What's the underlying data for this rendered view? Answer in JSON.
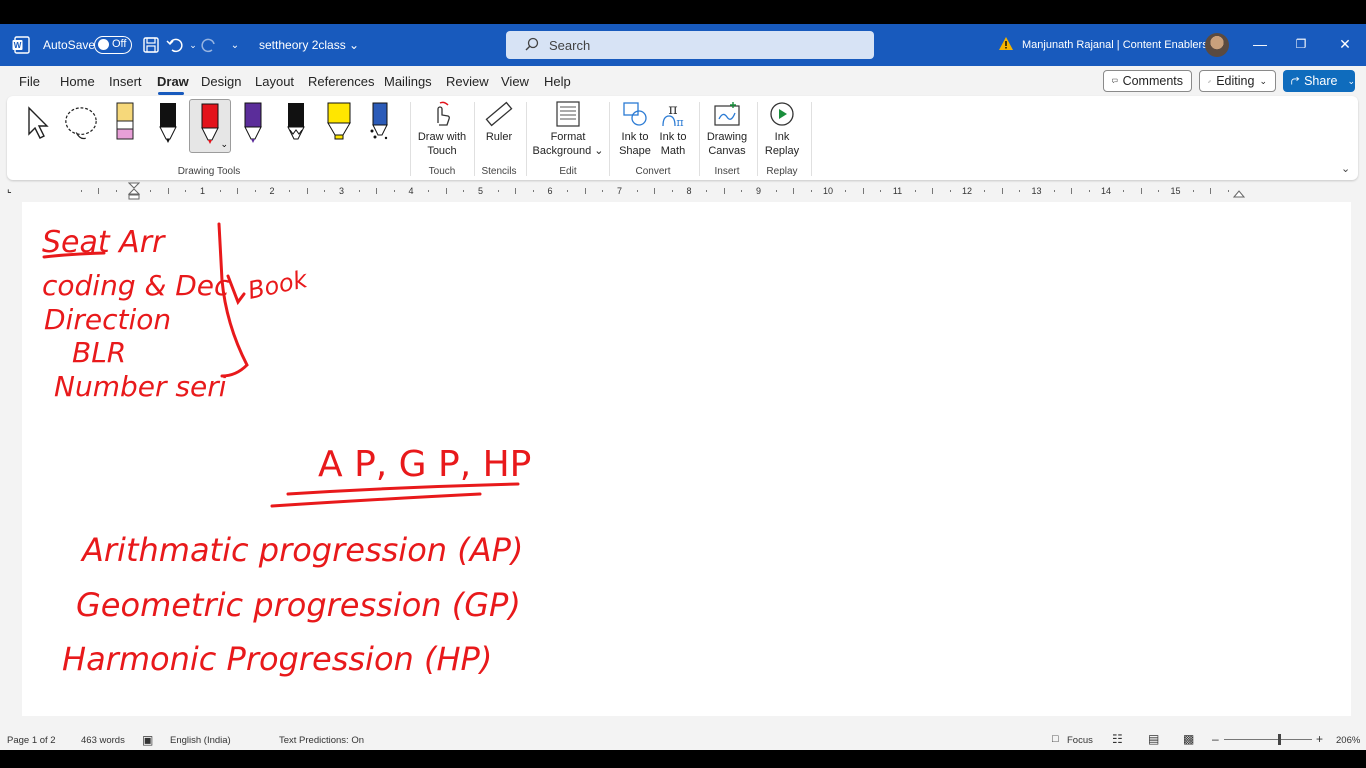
{
  "titlebar": {
    "autosave_label": "AutoSave",
    "autosave_state": "Off",
    "doc_title": "settheory 2class",
    "search_placeholder": "Search",
    "user": "Manjunath Rajanal | Content Enablers",
    "accent_color": "#185abd"
  },
  "menu": {
    "items": [
      "File",
      "Home",
      "Insert",
      "Draw",
      "Design",
      "Layout",
      "References",
      "Mailings",
      "Review",
      "View",
      "Help"
    ],
    "active": "Draw",
    "comments_label": "Comments",
    "editing_label": "Editing",
    "share_label": "Share"
  },
  "ribbon": {
    "drawing_tools_label": "Drawing Tools",
    "touch": {
      "button": [
        "Draw with",
        "Touch"
      ],
      "group": "Touch"
    },
    "stencils": {
      "button": "Ruler",
      "group": "Stencils"
    },
    "edit": {
      "button": [
        "Format",
        "Background"
      ],
      "group": "Edit"
    },
    "convert": {
      "ink_to_shape": [
        "Ink to",
        "Shape"
      ],
      "ink_to_math": [
        "Ink to",
        "Math"
      ],
      "group": "Convert"
    },
    "insert": {
      "button": [
        "Drawing",
        "Canvas"
      ],
      "group": "Insert"
    },
    "replay": {
      "button": [
        "Ink",
        "Replay"
      ],
      "group": "Replay"
    }
  },
  "ruler": {
    "numbers": [
      "1",
      "2",
      "3",
      "4",
      "5",
      "6",
      "7",
      "8",
      "9",
      "10",
      "11",
      "12",
      "13",
      "14",
      "15"
    ]
  },
  "ink": {
    "color": "#e8191b",
    "lines": [
      "Seat Arr",
      "coding & Dec",
      "Direction",
      "BLR",
      "Number seri",
      "Book",
      "A P, G P, HP",
      "Arithmatic progression (AP)",
      "Geometric progression (GP)",
      "Harmonic Progression (HP)"
    ]
  },
  "status": {
    "page": "Page 1 of 2",
    "words": "463 words",
    "language": "English (India)",
    "predictions": "Text Predictions: On",
    "focus": "Focus",
    "zoom": "206%"
  }
}
